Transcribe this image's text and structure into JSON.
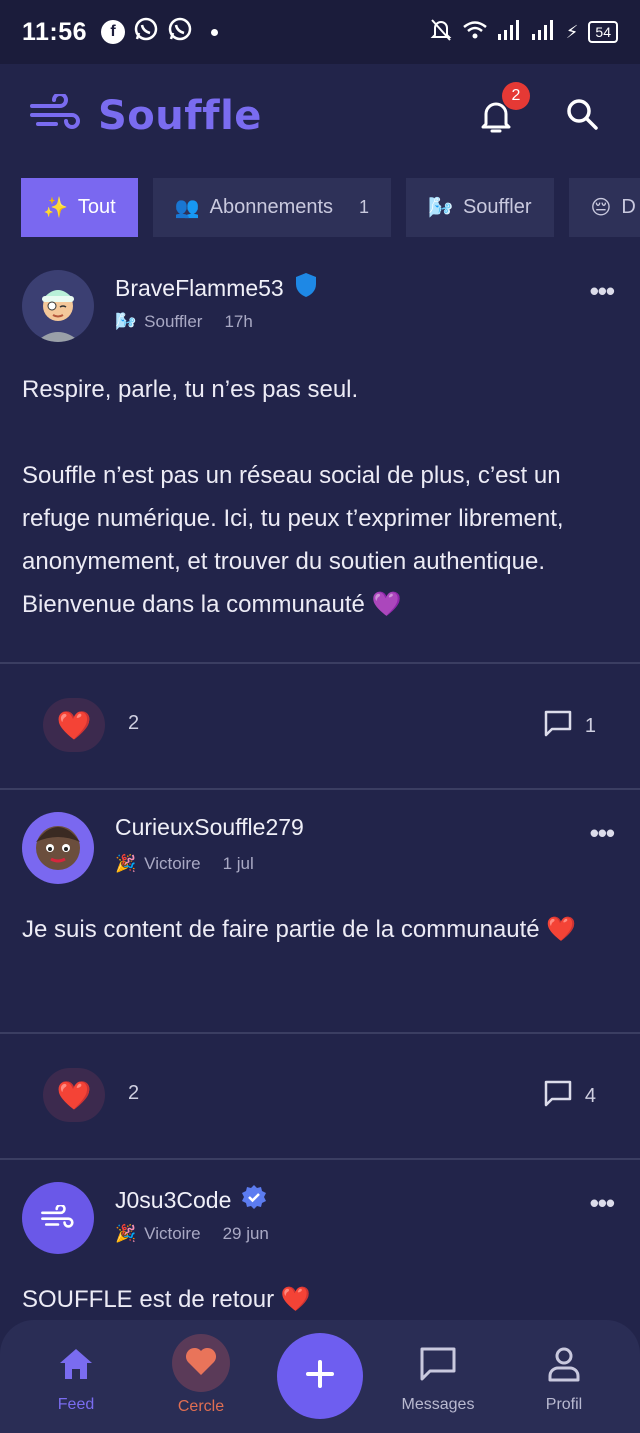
{
  "status_bar": {
    "time": "11:56",
    "battery": "54",
    "icons": [
      "facebook-icon",
      "whatsapp-icon",
      "whatsapp-icon",
      "notification-dot",
      "bell-off-icon",
      "wifi-icon",
      "signal-icon",
      "signal-icon",
      "charging-icon",
      "battery-icon"
    ]
  },
  "header": {
    "app_name": "Souffle",
    "notification_count": "2",
    "accent_color": "#7a6cf0"
  },
  "tabs": [
    {
      "emoji": "✨",
      "label": "Tout",
      "active": true
    },
    {
      "emoji": "👥",
      "label": "Abonnements",
      "count": "1"
    },
    {
      "emoji": "🌬️",
      "label": "Souffler"
    },
    {
      "emoji": "😔",
      "label": "D"
    }
  ],
  "posts": [
    {
      "username": "BraveFlamme53",
      "badge": "shield-icon",
      "category_emoji": "🌬️",
      "category": "Souffler",
      "time": "17h",
      "body_p1": "Respire, parle, tu n’es pas seul.",
      "body_p2": "Souffle n’est pas un réseau social de plus, c’est un refuge numérique. Ici, tu peux t’exprimer librement, anonymement, et trouver du soutien authentique. Bienvenue dans la communauté 💜",
      "likes": "2",
      "comments": "1"
    },
    {
      "username": "CurieuxSouffle279",
      "category_emoji": "🎉",
      "category": "Victoire",
      "time": "1 jul",
      "body_p1": "Je suis content de faire partie de la communauté ❤️",
      "likes": "2",
      "comments": "4"
    },
    {
      "username": "J0su3Code",
      "badge": "verified-icon",
      "category_emoji": "🎉",
      "category": "Victoire",
      "time": "29 jun",
      "body_p1": "SOUFFLE est de retour ❤️"
    }
  ],
  "bottom_nav": {
    "feed": "Feed",
    "cercle": "Cercle",
    "messages": "Messages",
    "profil": "Profil"
  }
}
